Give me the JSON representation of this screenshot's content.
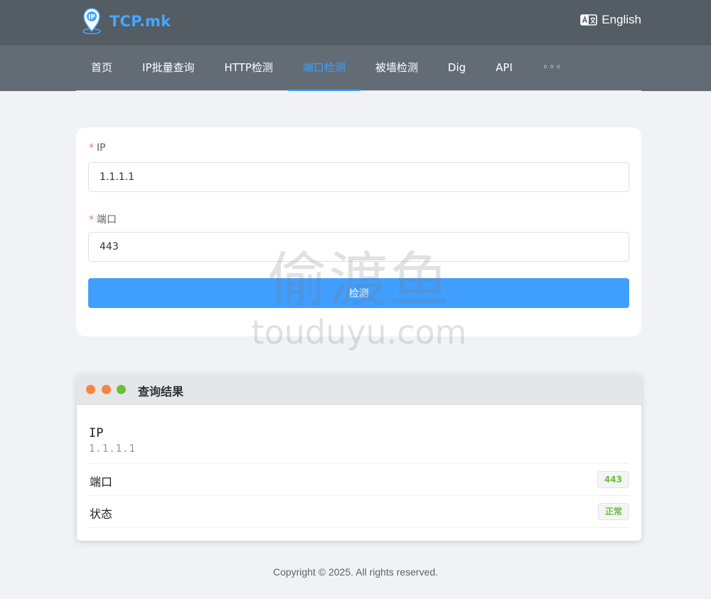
{
  "header": {
    "logo_text": "TCP.mk",
    "logo_badge": "IP",
    "language_label": "English",
    "colors": {
      "topbar": "#545c64",
      "navbar": "#636c75",
      "brand": "#45a7ff"
    }
  },
  "nav": {
    "items": [
      {
        "label": "首页",
        "active": false
      },
      {
        "label": "IP批量查询",
        "active": false
      },
      {
        "label": "HTTP检测",
        "active": false
      },
      {
        "label": "端口检测",
        "active": true
      },
      {
        "label": "被墙检测",
        "active": false
      },
      {
        "label": "Dig",
        "active": false
      },
      {
        "label": "API",
        "active": false
      }
    ],
    "more_label": "◦◦◦",
    "active_color": "#409eff"
  },
  "form": {
    "ip_label": "IP",
    "ip_value": "1.1.1.1",
    "port_label": "端口",
    "port_value": "443",
    "required_mark": "*",
    "submit_label": "检测"
  },
  "result": {
    "title": "查询结果",
    "window_dots": [
      "#f5853f",
      "#f5853f",
      "#67c23a"
    ],
    "ip_label": "IP",
    "ip_value": "1.1.1.1",
    "port_label": "端口",
    "port_value": "443",
    "status_label": "状态",
    "status_value": "正常"
  },
  "watermark": {
    "main": "偷渡鱼",
    "sub": "touduyu.com"
  },
  "footer": {
    "copyright": "Copyright © 2025. All rights reserved."
  }
}
